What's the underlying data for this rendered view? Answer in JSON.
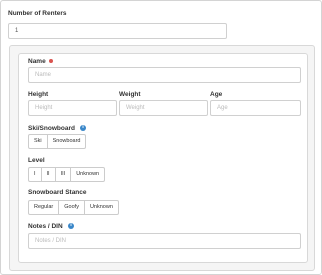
{
  "renters": {
    "label": "Number of Renters",
    "value": "1"
  },
  "name": {
    "label": "Name",
    "placeholder": "Name"
  },
  "height": {
    "label": "Height",
    "placeholder": "Height"
  },
  "weight": {
    "label": "Weight",
    "placeholder": "Weight"
  },
  "age": {
    "label": "Age",
    "placeholder": "Age"
  },
  "ski_snowboard": {
    "label": "Ski/Snowboard",
    "options": [
      "Ski",
      "Snowboard"
    ]
  },
  "level": {
    "label": "Level",
    "options": [
      "I",
      "II",
      "III",
      "Unknown"
    ]
  },
  "stance": {
    "label": "Snowboard Stance",
    "options": [
      "Regular",
      "Goofy",
      "Unknown"
    ]
  },
  "notes": {
    "label": "Notes / DIN",
    "placeholder": "Notes / DIN"
  },
  "colors": {
    "required": "#d9534f",
    "info": "#3a87c9"
  },
  "icons": {
    "required": "required-dot-icon",
    "info": "info-circle-icon"
  }
}
